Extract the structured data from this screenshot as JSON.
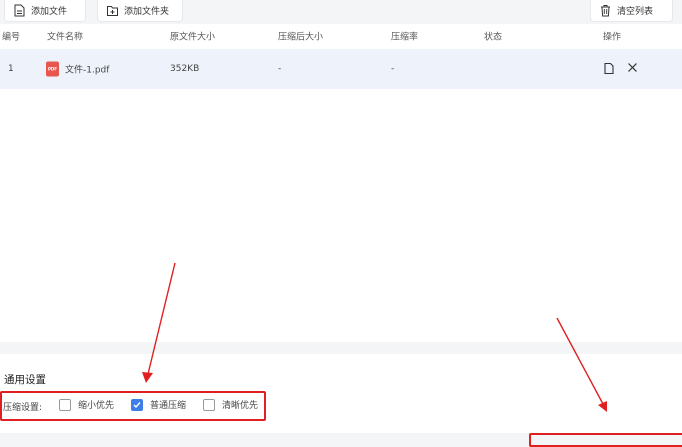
{
  "toolbar": {
    "add_file": "添加文件",
    "add_folder": "添加文件夹",
    "clear_list": "清空列表"
  },
  "table": {
    "headers": [
      "编号",
      "文件名称",
      "原文件大小",
      "压缩后大小",
      "压缩率",
      "状态",
      "操作"
    ],
    "rows": [
      {
        "index": "1",
        "name": "文件-1.pdf",
        "original_size": "352KB",
        "compressed_size": "-",
        "ratio": "-",
        "status": "",
        "file_icon_label": "PDF"
      }
    ]
  },
  "settings": {
    "title": "通用设置",
    "compress_label": "压缩设置:",
    "options": [
      {
        "label": "缩小优先",
        "checked": false
      },
      {
        "label": "普通压缩",
        "checked": true
      },
      {
        "label": "清晰优先",
        "checked": false
      }
    ]
  },
  "colors": {
    "accent": "#3f7ee8",
    "highlight": "#e02020",
    "pdf_icon": "#e8564f",
    "row_selected": "#eef3fb"
  },
  "icons": {
    "add_file": "file-add-icon",
    "add_folder": "folder-add-icon",
    "clear": "trash-icon",
    "open": "file-icon",
    "remove": "close-icon"
  }
}
